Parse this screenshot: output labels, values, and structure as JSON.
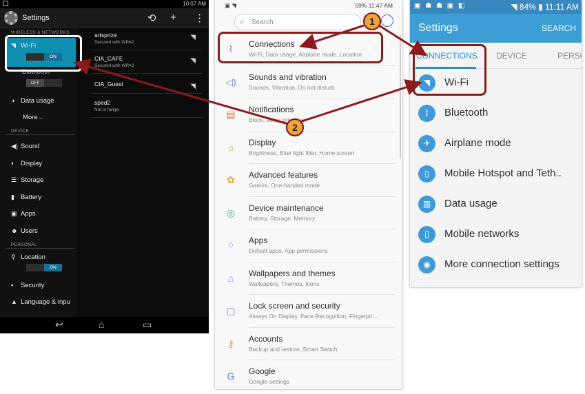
{
  "panel1": {
    "status_time": "10:07 AM",
    "title": "Settings",
    "sections": {
      "wireless": "WIRELESS & NETWORKS",
      "device": "DEVICE",
      "personal": "PERSONAL"
    },
    "wifi_label": "Wi-Fi",
    "wifi_toggle": "ON",
    "bluetooth_label": "Bluetooth",
    "bluetooth_toggle": "OFF",
    "nav": {
      "data_usage": "Data usage",
      "more": "More...",
      "sound": "Sound",
      "display": "Display",
      "storage": "Storage",
      "battery": "Battery",
      "apps": "Apps",
      "users": "Users",
      "location": "Location",
      "location_toggle": "ON",
      "security": "Security",
      "language": "Language & inpu"
    },
    "networks": [
      {
        "ssid": "artsprize",
        "security": "Secured with WPA2"
      },
      {
        "ssid": "CIA_CAFE",
        "security": "Secured with WPA2"
      },
      {
        "ssid": "CIA_Guest",
        "security": ""
      },
      {
        "ssid": "sped2",
        "security": "Not in range"
      }
    ]
  },
  "panel2": {
    "status_battery": "59%",
    "status_time": "11:47 AM",
    "search_placeholder": "Search",
    "items": [
      {
        "title": "Connections",
        "subtitle": "Wi-Fi, Data usage, Airplane mode, Location"
      },
      {
        "title": "Sounds and vibration",
        "subtitle": "Sounds, Vibration, Do not disturb"
      },
      {
        "title": "Notifications",
        "subtitle": "Block, allow, prioritize"
      },
      {
        "title": "Display",
        "subtitle": "Brightness, Blue light filter, Home screen"
      },
      {
        "title": "Advanced features",
        "subtitle": "Games, One-handed mode"
      },
      {
        "title": "Device maintenance",
        "subtitle": "Battery, Storage, Memory"
      },
      {
        "title": "Apps",
        "subtitle": "Default apps, App permissions"
      },
      {
        "title": "Wallpapers and themes",
        "subtitle": "Wallpapers, Themes, Icons"
      },
      {
        "title": "Lock screen and security",
        "subtitle": "Always On Display, Face Recognition, Fingerpri..."
      },
      {
        "title": "Accounts",
        "subtitle": "Backup and restore, Smart Switch"
      },
      {
        "title": "Google",
        "subtitle": "Google settings"
      }
    ]
  },
  "panel3": {
    "status_battery": "84%",
    "status_time": "11:11 AM",
    "title": "Settings",
    "search_action": "SEARCH",
    "tabs": [
      "CONNECTIONS",
      "DEVICE",
      "PERSO"
    ],
    "rows": [
      {
        "label": "Wi-Fi",
        "icon": "wifi-icon"
      },
      {
        "label": "Bluetooth",
        "icon": "bluetooth-icon"
      },
      {
        "label": "Airplane mode",
        "icon": "airplane-icon"
      },
      {
        "label": "Mobile Hotspot and Teth..",
        "icon": "hotspot-icon"
      },
      {
        "label": "Data usage",
        "icon": "data-usage-icon"
      },
      {
        "label": "Mobile networks",
        "icon": "mobile-networks-icon"
      },
      {
        "label": "More connection settings",
        "icon": "more-connections-icon"
      }
    ]
  },
  "callouts": [
    "1",
    "2"
  ],
  "colors": {
    "annotation": "#8c1a1a",
    "callout_fill": "#f2a23a",
    "wifi_highlight": "#0e8fb0",
    "samsung_blue": "#3d9ed6"
  }
}
